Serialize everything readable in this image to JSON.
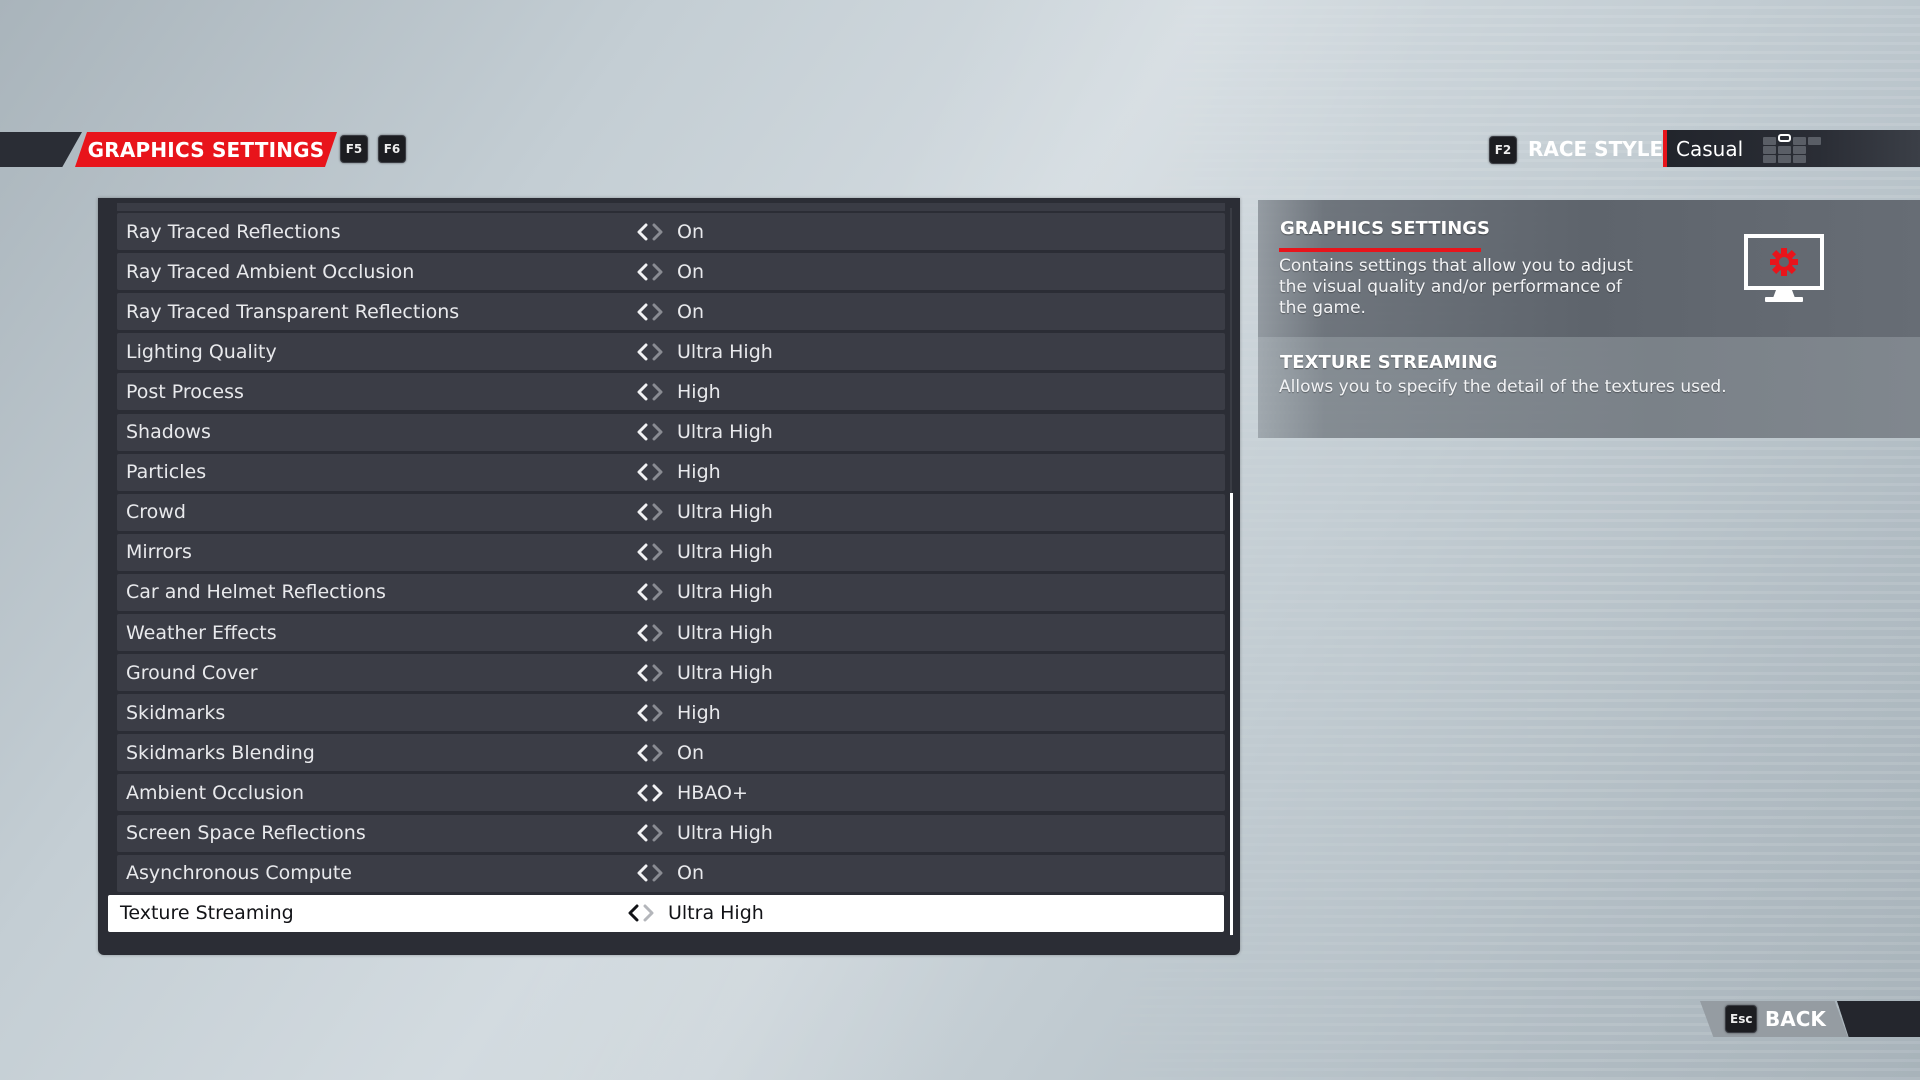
{
  "header": {
    "title": "GRAPHICS SETTINGS",
    "prev_key": "F5",
    "next_key": "F6",
    "race_style_key": "F2",
    "race_style_label": "RACE STYLE",
    "race_style_value": "Casual",
    "race_style_icon": "difficulty-grid-icon"
  },
  "settings": {
    "rows": [
      {
        "label": "Ray Traced Reflections",
        "value": "On",
        "can_prev": true,
        "can_next": false
      },
      {
        "label": "Ray Traced Ambient Occlusion",
        "value": "On",
        "can_prev": true,
        "can_next": false
      },
      {
        "label": "Ray Traced Transparent Reflections",
        "value": "On",
        "can_prev": true,
        "can_next": false
      },
      {
        "label": "Lighting Quality",
        "value": "Ultra High",
        "can_prev": true,
        "can_next": false
      },
      {
        "label": "Post Process",
        "value": "High",
        "can_prev": true,
        "can_next": false
      },
      {
        "label": "Shadows",
        "value": "Ultra High",
        "can_prev": true,
        "can_next": false
      },
      {
        "label": "Particles",
        "value": "High",
        "can_prev": true,
        "can_next": false
      },
      {
        "label": "Crowd",
        "value": "Ultra High",
        "can_prev": true,
        "can_next": false
      },
      {
        "label": "Mirrors",
        "value": "Ultra High",
        "can_prev": true,
        "can_next": false
      },
      {
        "label": "Car and Helmet Reflections",
        "value": "Ultra High",
        "can_prev": true,
        "can_next": false
      },
      {
        "label": "Weather Effects",
        "value": "Ultra High",
        "can_prev": true,
        "can_next": false
      },
      {
        "label": "Ground Cover",
        "value": "Ultra High",
        "can_prev": true,
        "can_next": false
      },
      {
        "label": "Skidmarks",
        "value": "High",
        "can_prev": true,
        "can_next": false
      },
      {
        "label": "Skidmarks Blending",
        "value": "On",
        "can_prev": true,
        "can_next": false
      },
      {
        "label": "Ambient Occlusion",
        "value": "HBAO+",
        "can_prev": true,
        "can_next": true
      },
      {
        "label": "Screen Space Reflections",
        "value": "Ultra High",
        "can_prev": true,
        "can_next": false
      },
      {
        "label": "Asynchronous Compute",
        "value": "On",
        "can_prev": true,
        "can_next": false
      },
      {
        "label": "Texture Streaming",
        "value": "Ultra High",
        "can_prev": true,
        "can_next": false
      }
    ],
    "selected_index": 17
  },
  "info": {
    "section_title": "GRAPHICS SETTINGS",
    "section_description": "Contains settings that allow you to adjust the visual quality and/or performance of the game.",
    "item_title": "TEXTURE STREAMING",
    "item_description": "Allows you to specify the detail of the textures used.",
    "icon": "monitor-gear-icon"
  },
  "footer": {
    "back_key": "Esc",
    "back_label": "BACK"
  },
  "colors": {
    "accent_red": "#e8141b",
    "row_bg": "#3b3d46",
    "panel_bg": "#2b2d35",
    "selected_bg": "#ffffff"
  }
}
